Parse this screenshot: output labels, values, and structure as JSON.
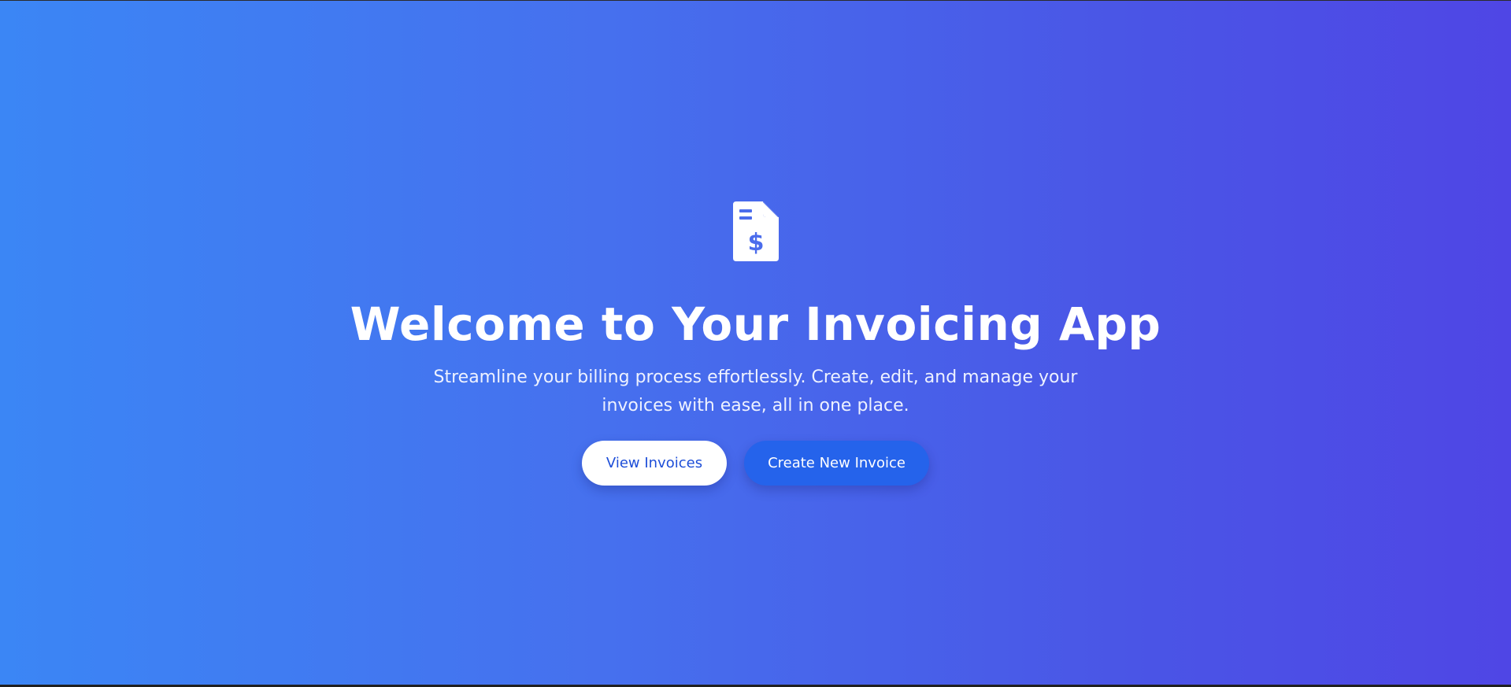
{
  "hero": {
    "icon": "invoice-dollar-icon",
    "title": "Welcome to Your Invoicing App",
    "subtitle": "Streamline your billing process effortlessly. Create, edit, and manage your invoices with ease, all in one place."
  },
  "actions": {
    "view_invoices_label": "View Invoices",
    "create_invoice_label": "Create New Invoice"
  },
  "colors": {
    "gradient_start": "#3b86f5",
    "gradient_end": "#4f46e5",
    "primary_button_bg": "#ffffff",
    "primary_button_text": "#1d4ed8",
    "secondary_button_bg": "#2563eb",
    "secondary_button_text": "#ffffff"
  }
}
